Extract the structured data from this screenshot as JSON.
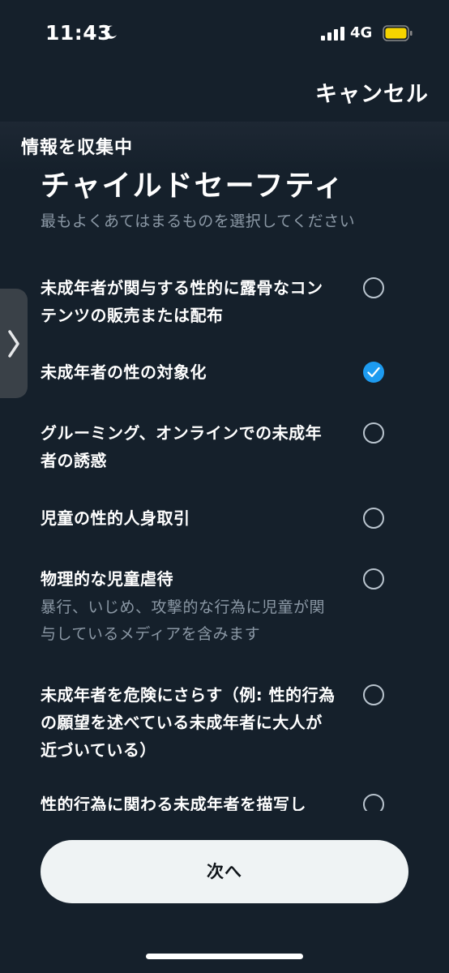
{
  "status_bar": {
    "time": "11:43",
    "network": "4G",
    "battery_color": "#f5d400",
    "icons": [
      "moon-icon",
      "signal-icon",
      "battery-icon"
    ]
  },
  "header": {
    "cancel_label": "キャンセル"
  },
  "loading_banner": {
    "text": "情報を収集中"
  },
  "section": {
    "title": "チャイルドセーフティ",
    "subtitle": "最もよくあてはまるものを選択してください"
  },
  "options": [
    {
      "label": "未成年者が関与する性的に露骨なコンテンツの販売または配布",
      "description": "",
      "selected": false
    },
    {
      "label": "未成年者の性の対象化",
      "description": "",
      "selected": true
    },
    {
      "label": "グルーミング、オンラインでの未成年者の誘惑",
      "description": "",
      "selected": false
    },
    {
      "label": "児童の性的人身取引",
      "description": "",
      "selected": false
    },
    {
      "label": "物理的な児童虐待",
      "description": "暴行、いじめ、攻撃的な行為に児童が関与しているメディアを含みます",
      "selected": false
    },
    {
      "label": "未成年者を危険にさらす（例: 性的行為の願望を述べている未成年者に大人が近づいている）",
      "description": "",
      "selected": false
    },
    {
      "label": "性的行為に関わる未成年者を描写し",
      "description": "",
      "selected": false
    }
  ],
  "next_button": {
    "label": "次へ"
  },
  "colors": {
    "background": "#15202b",
    "accent": "#1d9bf0",
    "secondary_text": "#8b98a5",
    "button_bg": "#eff3f4"
  }
}
